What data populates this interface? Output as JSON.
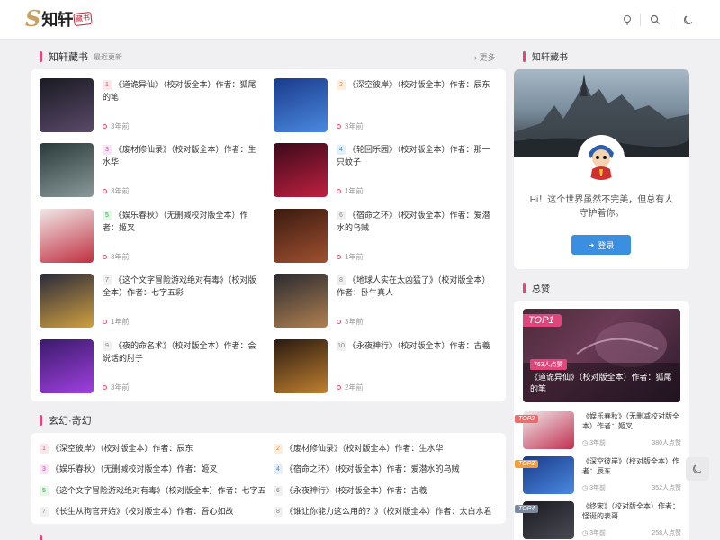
{
  "header": {
    "logo_mark": "S",
    "logo_text": "知轩",
    "logo_seal": "藏书"
  },
  "main": {
    "section1": {
      "title": "知轩藏书",
      "subtitle": "最近更新",
      "more": "更多"
    },
    "books": [
      {
        "num": "1",
        "title": "《道诡异仙》（校对版全本）作者：狐尾的笔",
        "time": "3年前"
      },
      {
        "num": "2",
        "title": "《深空彼岸》（校对版全本）作者：辰东",
        "time": "3年前"
      },
      {
        "num": "3",
        "title": "《废材修仙录》（校对版全本）作者：生水华",
        "time": "3年前"
      },
      {
        "num": "4",
        "title": "《轮回乐园》（校对版全本）作者：那一只蚊子",
        "time": "1年前"
      },
      {
        "num": "5",
        "title": "《娱乐春秋》（无删减校对版全本）作者：姬叉",
        "time": "3年前"
      },
      {
        "num": "6",
        "title": "《宿命之环》（校对版全本）作者：爱潜水的乌贼",
        "time": "1年前"
      },
      {
        "num": "7",
        "title": "《这个文字冒险游戏绝对有毒》（校对版全本）作者：七字五彩",
        "time": "1年前"
      },
      {
        "num": "8",
        "title": "《地球人实在太凶猛了》（校对版全本）作者：卧牛真人",
        "time": "3年前"
      },
      {
        "num": "9",
        "title": "《夜的命名术》（校对版全本）作者：会说话的肘子",
        "time": "3年前"
      },
      {
        "num": "10",
        "title": "《永夜神行》（校对版全本）作者：古羲",
        "time": "2年前"
      }
    ],
    "section2": {
      "title": "玄幻·奇幻"
    },
    "list": [
      {
        "num": "1",
        "text": "《深空彼岸》（校对版全本）作者：辰东"
      },
      {
        "num": "2",
        "text": "《废材修仙录》（校对版全本）作者：生水华"
      },
      {
        "num": "3",
        "text": "《娱乐春秋》（无删减校对版全本）作者：姬叉"
      },
      {
        "num": "4",
        "text": "《宿命之环》（校对版全本）作者：爱潜水的乌贼"
      },
      {
        "num": "5",
        "text": "《这个文字冒险游戏绝对有毒》（校对版全本）作者：七字五彩"
      },
      {
        "num": "6",
        "text": "《永夜神行》（校对版全本）作者：古羲"
      },
      {
        "num": "7",
        "text": "《长生从狗官开始》（校对版全本）作者：吾心如故"
      },
      {
        "num": "8",
        "text": "《谁让你能力这么用的？》（校对版全本）作者：太白水君"
      }
    ]
  },
  "sidebar": {
    "profile": {
      "title": "知轩藏书",
      "welcome": "Hi！这个世界虽然不完美，但总有人守护着你。",
      "login_label": "登录"
    },
    "ranking": {
      "title": "总赞",
      "top1": {
        "tag": "TOP1",
        "likes": "763人点赞",
        "title": "《道诡异仙》（校对版全本）作者：狐尾的笔"
      },
      "items": [
        {
          "tag": "TOP2",
          "title": "《娱乐春秋》（无删减校对版全本）作者：姬叉",
          "time": "3年前",
          "likes": "380人点赞",
          "color": "#f06a6a"
        },
        {
          "tag": "TOP3",
          "title": "《深空彼岸》（校对版全本）作者：辰东",
          "time": "3年前",
          "likes": "352人点赞",
          "color": "#f29c3a"
        },
        {
          "tag": "TOP4",
          "title": "《终宋》（校对版全本）作者：怪诞的表哥",
          "time": "3年前",
          "likes": "258人点赞",
          "color": "#7a8aa0"
        }
      ]
    }
  },
  "colors": {
    "accent": "#e0457b",
    "login": "#3b8fe0"
  },
  "icons": [
    "bulb-icon",
    "search-icon",
    "moon-icon",
    "chevron-right-icon",
    "clock-icon",
    "user-icon"
  ]
}
